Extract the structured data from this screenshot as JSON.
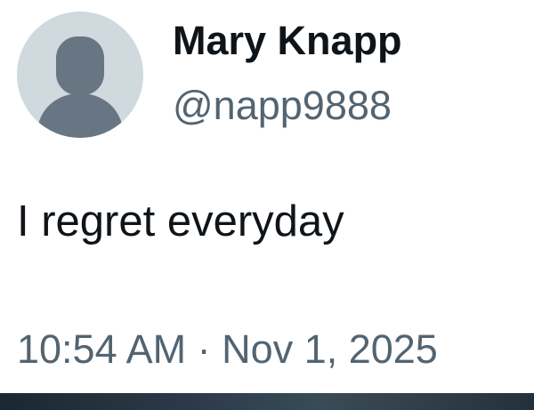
{
  "tweet": {
    "display_name": "Mary Knapp",
    "handle": "@napp9888",
    "text": "I regret everyday",
    "time": "10:54 AM",
    "separator": "·",
    "date": "Nov 1, 2025"
  },
  "avatar": {
    "icon": "default-avatar-silhouette-icon",
    "background_color": "#cfd9de",
    "silhouette_color": "#687684"
  },
  "colors": {
    "primary_text": "#0f1419",
    "secondary_text": "#536471",
    "background": "#ffffff"
  }
}
